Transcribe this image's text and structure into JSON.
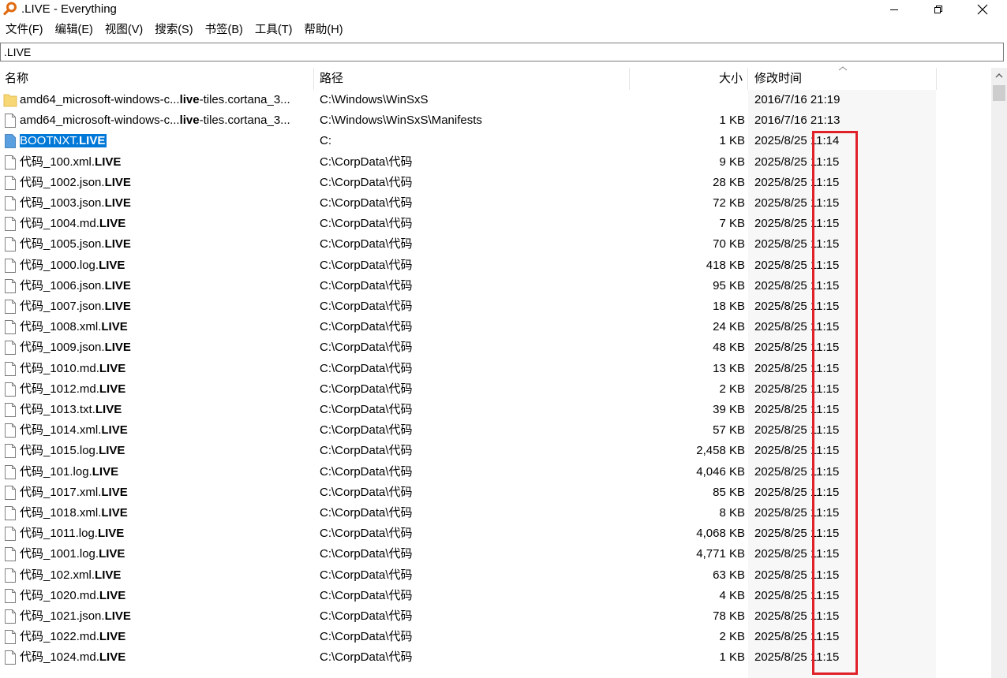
{
  "window": {
    "title": ".LIVE - Everything"
  },
  "menu": [
    {
      "label": "文件(F)"
    },
    {
      "label": "编辑(E)"
    },
    {
      "label": "视图(V)"
    },
    {
      "label": "搜索(S)"
    },
    {
      "label": "书签(B)"
    },
    {
      "label": "工具(T)"
    },
    {
      "label": "帮助(H)"
    }
  ],
  "search": {
    "value": ".LIVE"
  },
  "columns": {
    "name": "名称",
    "path": "路径",
    "size": "大小",
    "modified": "修改时间"
  },
  "rows": [
    {
      "icon": "folder-icon",
      "name_pre": "amd64_microsoft-windows-c...",
      "name_bold": "live",
      "name_post": "-tiles.cortana_3...",
      "path": "C:\\Windows\\WinSxS",
      "size": "",
      "date": "2016/7/16 21:19"
    },
    {
      "icon": "file-icon",
      "name_pre": "amd64_microsoft-windows-c...",
      "name_bold": "live",
      "name_post": "-tiles.cortana_3...",
      "path": "C:\\Windows\\WinSxS\\Manifests",
      "size": "1 KB",
      "date": "2016/7/16 21:13"
    },
    {
      "icon": "file-selected-icon",
      "selected": true,
      "name_pre": "BOOTNXT.",
      "name_bold": "LIVE",
      "name_post": "",
      "path": "C:",
      "size": "1 KB",
      "date": "2025/8/25 11:14"
    },
    {
      "icon": "file-icon",
      "name_pre": "代码_100.xml.",
      "name_bold": "LIVE",
      "name_post": "",
      "path": "C:\\CorpData\\代码",
      "size": "9 KB",
      "date": "2025/8/25 11:15"
    },
    {
      "icon": "file-icon",
      "name_pre": "代码_1002.json.",
      "name_bold": "LIVE",
      "name_post": "",
      "path": "C:\\CorpData\\代码",
      "size": "28 KB",
      "date": "2025/8/25 11:15"
    },
    {
      "icon": "file-icon",
      "name_pre": "代码_1003.json.",
      "name_bold": "LIVE",
      "name_post": "",
      "path": "C:\\CorpData\\代码",
      "size": "72 KB",
      "date": "2025/8/25 11:15"
    },
    {
      "icon": "file-icon",
      "name_pre": "代码_1004.md.",
      "name_bold": "LIVE",
      "name_post": "",
      "path": "C:\\CorpData\\代码",
      "size": "7 KB",
      "date": "2025/8/25 11:15"
    },
    {
      "icon": "file-icon",
      "name_pre": "代码_1005.json.",
      "name_bold": "LIVE",
      "name_post": "",
      "path": "C:\\CorpData\\代码",
      "size": "70 KB",
      "date": "2025/8/25 11:15"
    },
    {
      "icon": "file-icon",
      "name_pre": "代码_1000.log.",
      "name_bold": "LIVE",
      "name_post": "",
      "path": "C:\\CorpData\\代码",
      "size": "418 KB",
      "date": "2025/8/25 11:15"
    },
    {
      "icon": "file-icon",
      "name_pre": "代码_1006.json.",
      "name_bold": "LIVE",
      "name_post": "",
      "path": "C:\\CorpData\\代码",
      "size": "95 KB",
      "date": "2025/8/25 11:15"
    },
    {
      "icon": "file-icon",
      "name_pre": "代码_1007.json.",
      "name_bold": "LIVE",
      "name_post": "",
      "path": "C:\\CorpData\\代码",
      "size": "18 KB",
      "date": "2025/8/25 11:15"
    },
    {
      "icon": "file-icon",
      "name_pre": "代码_1008.xml.",
      "name_bold": "LIVE",
      "name_post": "",
      "path": "C:\\CorpData\\代码",
      "size": "24 KB",
      "date": "2025/8/25 11:15"
    },
    {
      "icon": "file-icon",
      "name_pre": "代码_1009.json.",
      "name_bold": "LIVE",
      "name_post": "",
      "path": "C:\\CorpData\\代码",
      "size": "48 KB",
      "date": "2025/8/25 11:15"
    },
    {
      "icon": "file-icon",
      "name_pre": "代码_1010.md.",
      "name_bold": "LIVE",
      "name_post": "",
      "path": "C:\\CorpData\\代码",
      "size": "13 KB",
      "date": "2025/8/25 11:15"
    },
    {
      "icon": "file-icon",
      "name_pre": "代码_1012.md.",
      "name_bold": "LIVE",
      "name_post": "",
      "path": "C:\\CorpData\\代码",
      "size": "2 KB",
      "date": "2025/8/25 11:15"
    },
    {
      "icon": "file-icon",
      "name_pre": "代码_1013.txt.",
      "name_bold": "LIVE",
      "name_post": "",
      "path": "C:\\CorpData\\代码",
      "size": "39 KB",
      "date": "2025/8/25 11:15"
    },
    {
      "icon": "file-icon",
      "name_pre": "代码_1014.xml.",
      "name_bold": "LIVE",
      "name_post": "",
      "path": "C:\\CorpData\\代码",
      "size": "57 KB",
      "date": "2025/8/25 11:15"
    },
    {
      "icon": "file-icon",
      "name_pre": "代码_1015.log.",
      "name_bold": "LIVE",
      "name_post": "",
      "path": "C:\\CorpData\\代码",
      "size": "2,458 KB",
      "date": "2025/8/25 11:15"
    },
    {
      "icon": "file-icon",
      "name_pre": "代码_101.log.",
      "name_bold": "LIVE",
      "name_post": "",
      "path": "C:\\CorpData\\代码",
      "size": "4,046 KB",
      "date": "2025/8/25 11:15"
    },
    {
      "icon": "file-icon",
      "name_pre": "代码_1017.xml.",
      "name_bold": "LIVE",
      "name_post": "",
      "path": "C:\\CorpData\\代码",
      "size": "85 KB",
      "date": "2025/8/25 11:15"
    },
    {
      "icon": "file-icon",
      "name_pre": "代码_1018.xml.",
      "name_bold": "LIVE",
      "name_post": "",
      "path": "C:\\CorpData\\代码",
      "size": "8 KB",
      "date": "2025/8/25 11:15"
    },
    {
      "icon": "file-icon",
      "name_pre": "代码_1011.log.",
      "name_bold": "LIVE",
      "name_post": "",
      "path": "C:\\CorpData\\代码",
      "size": "4,068 KB",
      "date": "2025/8/25 11:15"
    },
    {
      "icon": "file-icon",
      "name_pre": "代码_1001.log.",
      "name_bold": "LIVE",
      "name_post": "",
      "path": "C:\\CorpData\\代码",
      "size": "4,771 KB",
      "date": "2025/8/25 11:15"
    },
    {
      "icon": "file-icon",
      "name_pre": "代码_102.xml.",
      "name_bold": "LIVE",
      "name_post": "",
      "path": "C:\\CorpData\\代码",
      "size": "63 KB",
      "date": "2025/8/25 11:15"
    },
    {
      "icon": "file-icon",
      "name_pre": "代码_1020.md.",
      "name_bold": "LIVE",
      "name_post": "",
      "path": "C:\\CorpData\\代码",
      "size": "4 KB",
      "date": "2025/8/25 11:15"
    },
    {
      "icon": "file-icon",
      "name_pre": "代码_1021.json.",
      "name_bold": "LIVE",
      "name_post": "",
      "path": "C:\\CorpData\\代码",
      "size": "78 KB",
      "date": "2025/8/25 11:15"
    },
    {
      "icon": "file-icon",
      "name_pre": "代码_1022.md.",
      "name_bold": "LIVE",
      "name_post": "",
      "path": "C:\\CorpData\\代码",
      "size": "2 KB",
      "date": "2025/8/25 11:15"
    },
    {
      "icon": "file-icon",
      "name_pre": "代码_1024.md.",
      "name_bold": "LIVE",
      "name_post": "",
      "path": "C:\\CorpData\\代码",
      "size": "1 KB",
      "date": "2025/8/25 11:15"
    }
  ],
  "colors": {
    "selection": "#0078d7",
    "highlight_box": "#e0212a",
    "folder": "#f6d365"
  }
}
